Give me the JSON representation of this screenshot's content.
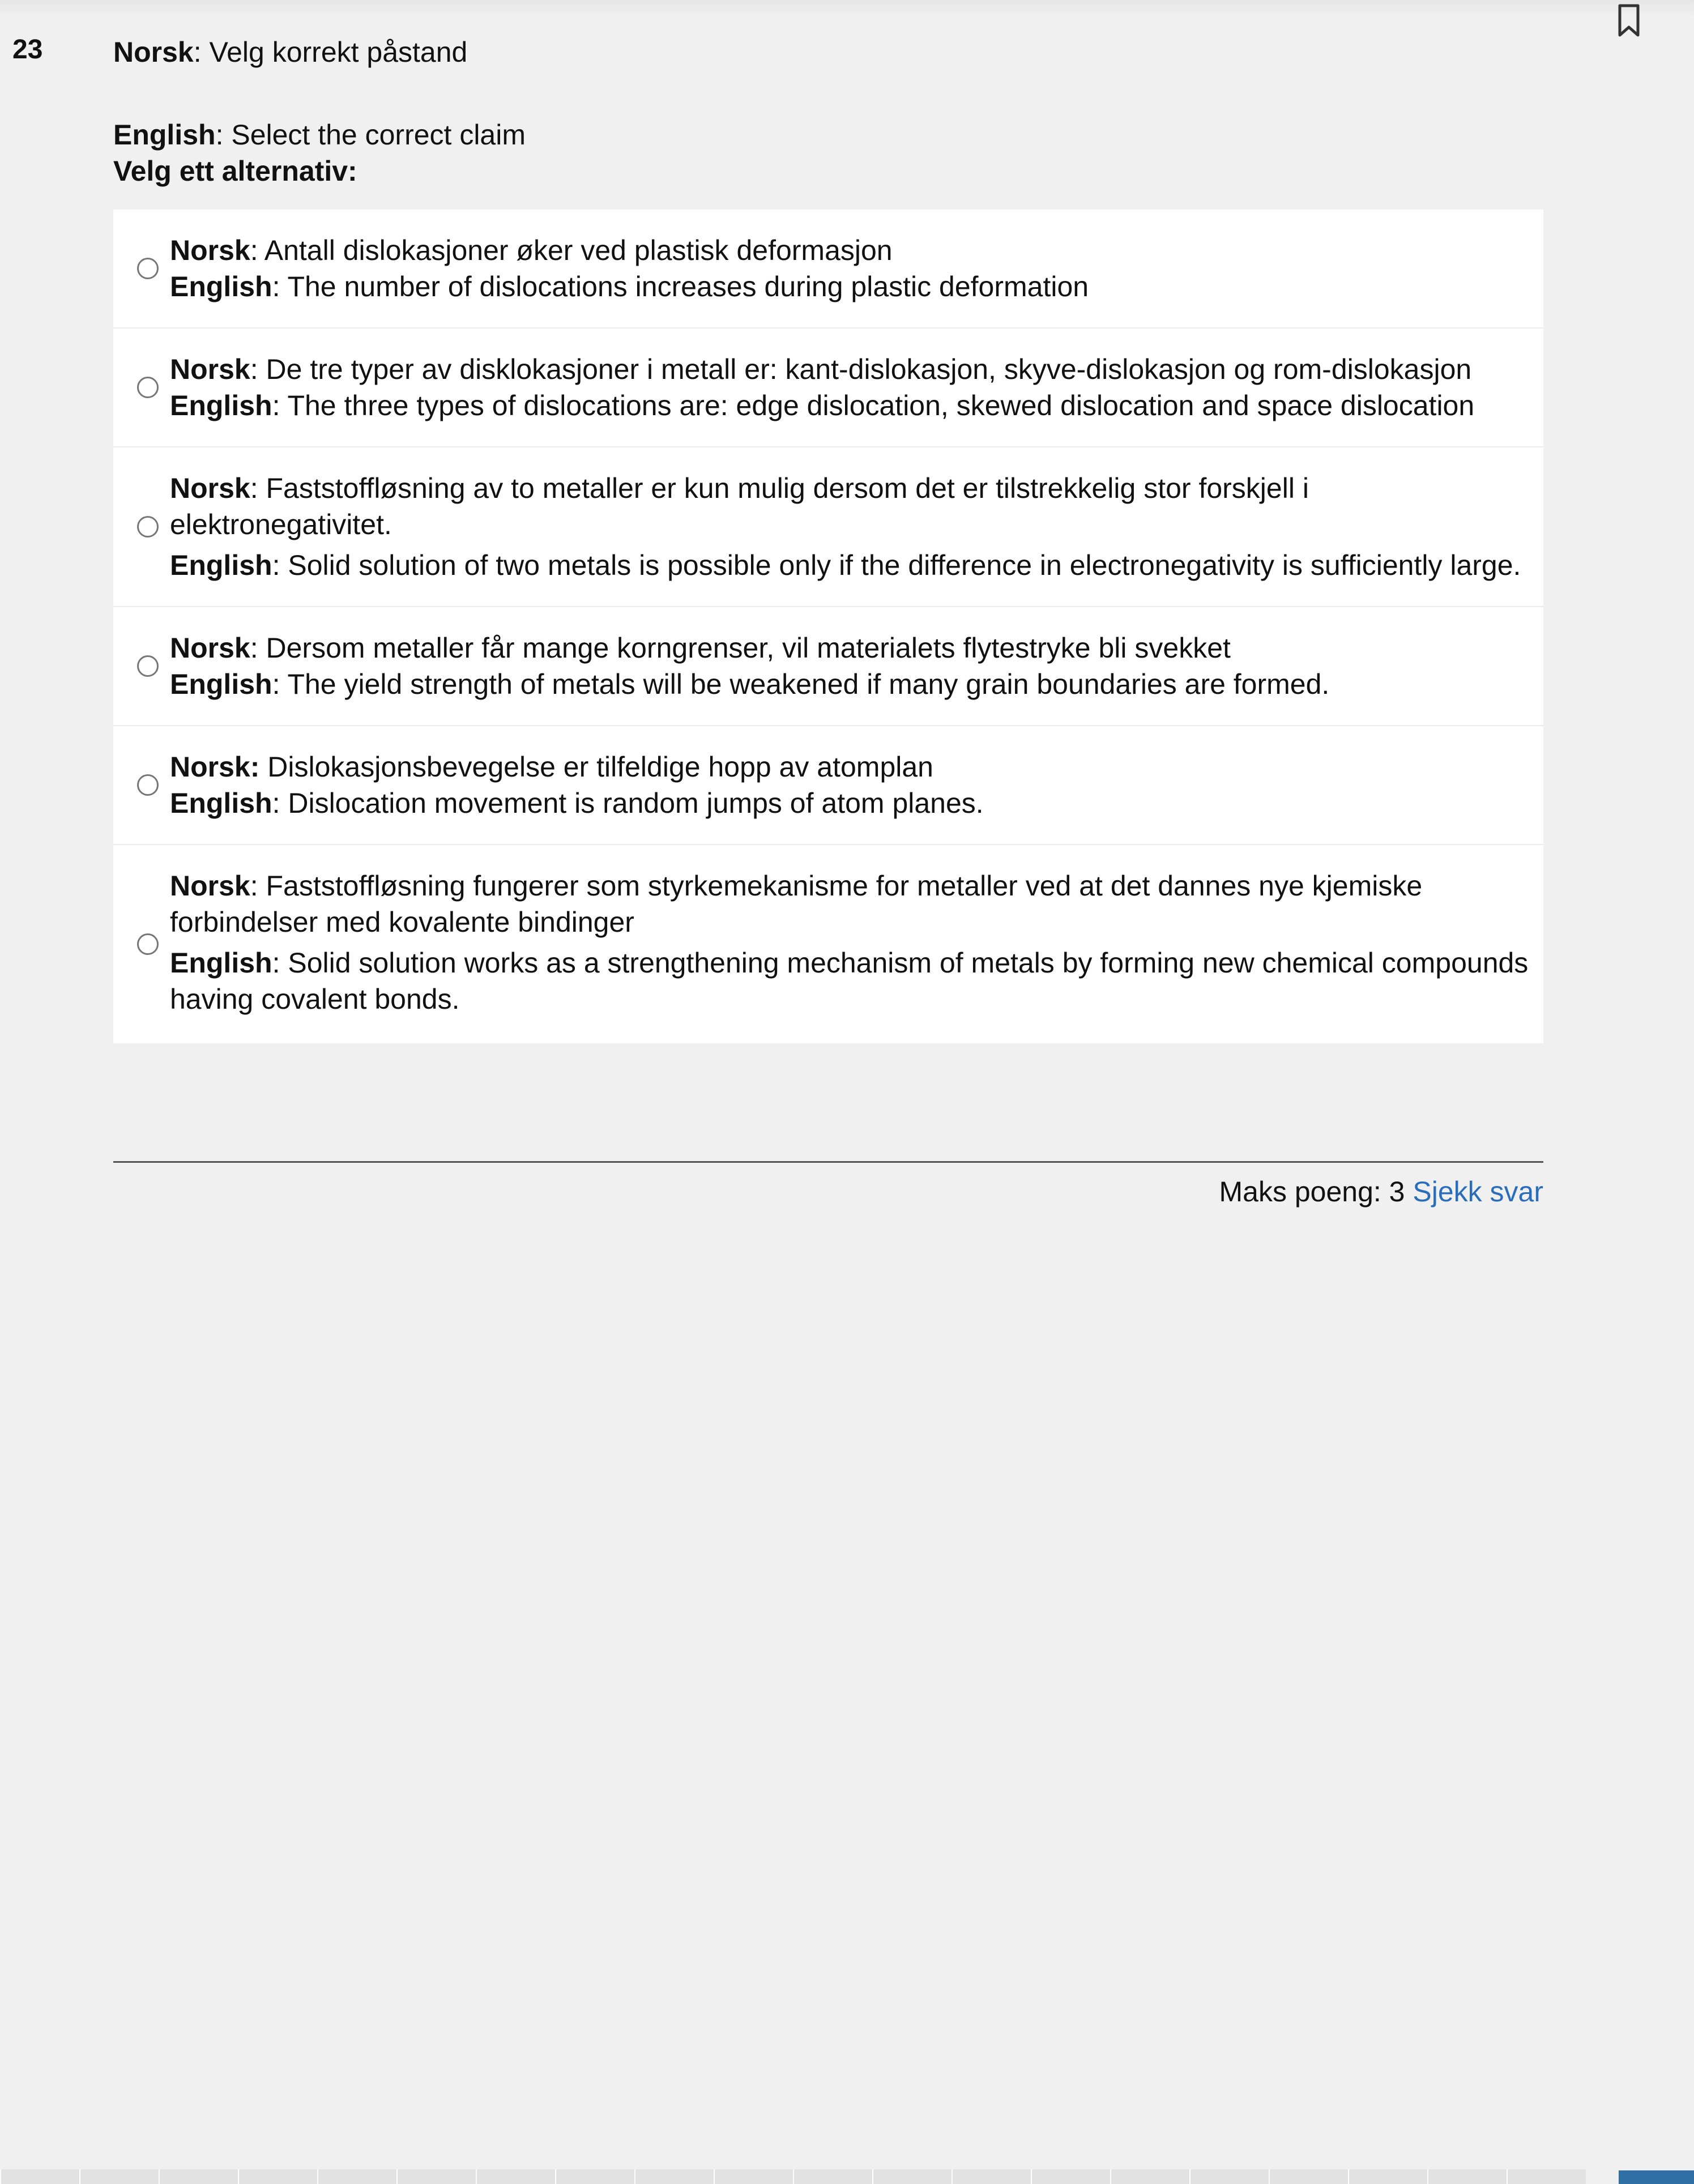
{
  "question": {
    "number": "23",
    "norsk_label": "Norsk",
    "norsk_text": ": Velg korrekt påstand",
    "english_label": "English",
    "english_text": ": Select the correct claim",
    "instruction": "Velg ett alternativ:"
  },
  "options": [
    {
      "norsk_label": "Norsk",
      "norsk_text": ": Antall dislokasjoner øker ved plastisk deformasjon",
      "english_label": "English",
      "english_text": ": The number of dislocations increases during plastic deformation"
    },
    {
      "norsk_label": "Norsk",
      "norsk_text": ": De tre typer av disklokasjoner i metall er: kant-dislokasjon, skyve-dislokasjon og rom-dislokasjon",
      "english_label": "English",
      "english_text": ": The three types of dislocations are: edge dislocation, skewed dislocation and space dislocation"
    },
    {
      "norsk_label": "Norsk",
      "norsk_text": ": Faststoffløsning av to metaller er kun mulig dersom det er tilstrekkelig stor forskjell i elektronegativitet.",
      "english_label": "English",
      "english_text": ": Solid solution of two metals is possible only if the difference in electronegativity is sufficiently large."
    },
    {
      "norsk_label": "Norsk",
      "norsk_text": ": Dersom metaller får mange korngrenser, vil materialets flytestryke bli svekket",
      "english_label": "English",
      "english_text": ": The yield strength of metals will be weakened if many grain boundaries are formed."
    },
    {
      "norsk_label": "Norsk:",
      "norsk_text": " Dislokasjonsbevegelse er tilfeldige hopp av atomplan",
      "english_label": "English",
      "english_text": ": Dislocation movement is random jumps of atom planes."
    },
    {
      "norsk_label": "Norsk",
      "norsk_text": ": Faststoffløsning fungerer som styrkemekanisme for metaller ved at det dannes nye kjemiske forbindelser med kovalente bindinger",
      "english_label": "English",
      "english_text": ": Solid solution works as a strengthening mechanism of metals by forming new chemical compounds having covalent bonds."
    }
  ],
  "footer": {
    "max_points_label": "Maks poeng: 3",
    "check_answer": "Sjekk svar"
  },
  "icons": {
    "bookmark": "bookmark-icon"
  },
  "colors": {
    "link": "#2a6ebb",
    "nav_active": "#2f6fa6"
  }
}
